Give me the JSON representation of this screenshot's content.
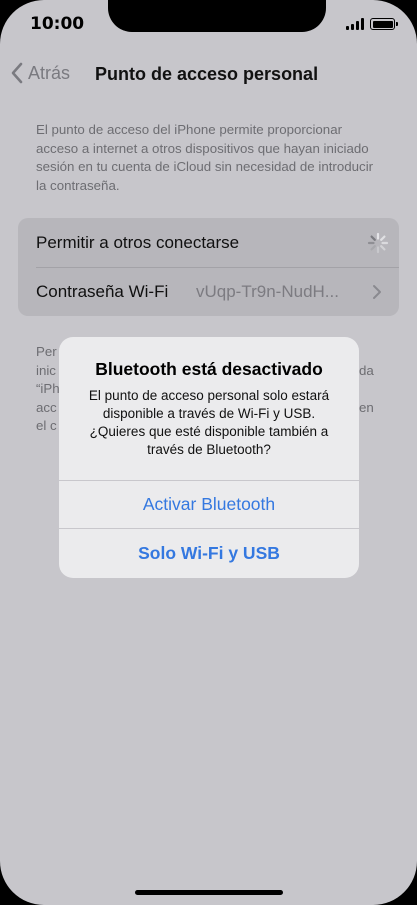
{
  "status": {
    "time": "10:00"
  },
  "nav": {
    "back_label": "Atrás",
    "title": "Punto de acceso personal"
  },
  "description": "El punto de acceso del iPhone permite proporcionar acceso a internet a otros dispositivos que hayan iniciado sesión en tu cuenta de iCloud sin necesidad de introducir la contraseña.",
  "settings": {
    "allow_others_label": "Permitir a otros conectarse",
    "wifi_password_label": "Contraseña Wi-Fi",
    "wifi_password_value": "vUqp-Tr9n-NudH..."
  },
  "footer_partial": {
    "lines": [
      "Per",
      "inic",
      "“iPh",
      "acc",
      "el c"
    ],
    "right_fragments": [
      "da",
      "en"
    ]
  },
  "alert": {
    "title": "Bluetooth está desactivado",
    "message": "El punto de acceso personal solo estará disponible a través de Wi-Fi y USB. ¿Quieres que esté disponible también a través de Bluetooth?",
    "primary_button": "Activar Bluetooth",
    "secondary_button": "Solo Wi-Fi y USB"
  },
  "colors": {
    "accent": "#3478e0",
    "background": "#c7c6cb",
    "alert_bg": "#ebebed"
  },
  "icons": {
    "back": "chevron-left-icon",
    "loading": "spinner-icon",
    "disclosure": "chevron-right-icon"
  }
}
